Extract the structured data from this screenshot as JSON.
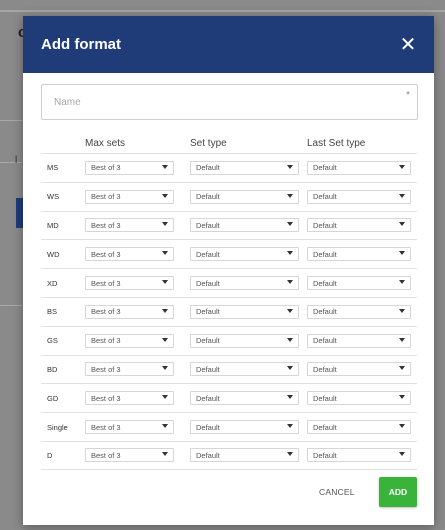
{
  "background": {
    "app_letter": "c",
    "tick_label": "l"
  },
  "dialog": {
    "title": "Add format",
    "close_icon": "close-icon",
    "name_field": {
      "placeholder": "Name",
      "value": "",
      "required_mark": "*"
    },
    "columns": {
      "max_sets": "Max sets",
      "set_type": "Set type",
      "last_set_type": "Last Set type"
    },
    "rows": [
      {
        "code": "MS",
        "max_sets": "Best of 3",
        "set_type": "Default",
        "last_set_type": "Default"
      },
      {
        "code": "WS",
        "max_sets": "Best of 3",
        "set_type": "Default",
        "last_set_type": "Default"
      },
      {
        "code": "MD",
        "max_sets": "Best of 3",
        "set_type": "Default",
        "last_set_type": "Default"
      },
      {
        "code": "WD",
        "max_sets": "Best of 3",
        "set_type": "Default",
        "last_set_type": "Default"
      },
      {
        "code": "XD",
        "max_sets": "Best of 3",
        "set_type": "Default",
        "last_set_type": "Default"
      },
      {
        "code": "BS",
        "max_sets": "Best of 3",
        "set_type": "Default",
        "last_set_type": "Default"
      },
      {
        "code": "GS",
        "max_sets": "Best of 3",
        "set_type": "Default",
        "last_set_type": "Default"
      },
      {
        "code": "BD",
        "max_sets": "Best of 3",
        "set_type": "Default",
        "last_set_type": "Default"
      },
      {
        "code": "GD",
        "max_sets": "Best of 3",
        "set_type": "Default",
        "last_set_type": "Default"
      },
      {
        "code": "Single",
        "max_sets": "Best of 3",
        "set_type": "Default",
        "last_set_type": "Default"
      },
      {
        "code": "D",
        "max_sets": "Best of 3",
        "set_type": "Default",
        "last_set_type": "Default"
      }
    ],
    "footer": {
      "cancel_label": "CANCEL",
      "add_label": "ADD"
    },
    "colors": {
      "header": "#1f3b78",
      "add_button": "#3ab33a"
    }
  }
}
